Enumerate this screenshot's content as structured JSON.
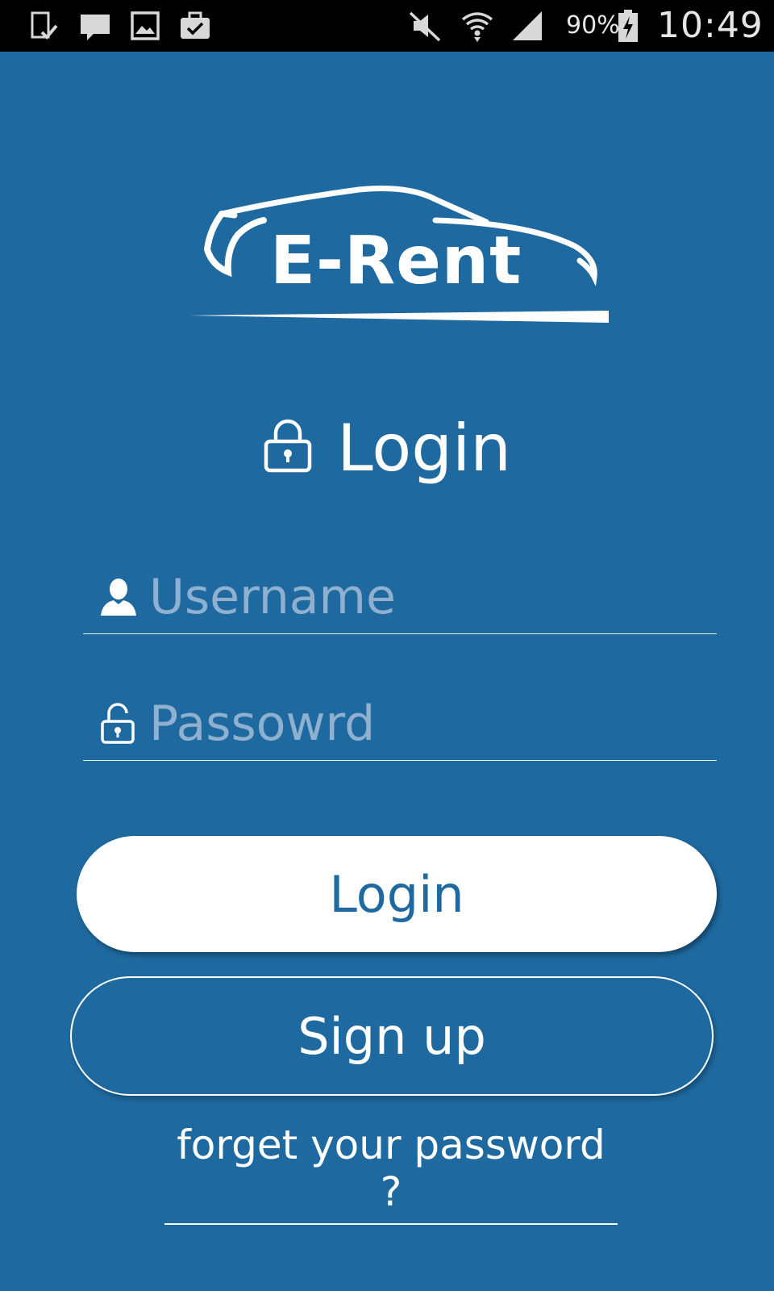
{
  "status_bar": {
    "battery_percent": "90%",
    "time": "10:49",
    "notification_icons": [
      "download-check-icon",
      "message-icon",
      "image-icon",
      "briefcase-check-icon"
    ],
    "system_icons": [
      "mute-icon",
      "wifi-icon",
      "signal-icon",
      "battery-charging-icon"
    ]
  },
  "logo": {
    "brand": "E-Rent",
    "icon": "car-outline-icon"
  },
  "heading": {
    "icon": "lock-icon",
    "title": "Login"
  },
  "form": {
    "username": {
      "icon": "user-icon",
      "placeholder": "Username",
      "value": ""
    },
    "password": {
      "icon": "unlock-icon",
      "placeholder": "Passowrd",
      "value": ""
    }
  },
  "actions": {
    "login_label": "Login",
    "signup_label": "Sign up",
    "forgot_label": "forget your password ?"
  },
  "colors": {
    "background": "#1e699f",
    "primary_text": "#ffffff",
    "placeholder": "#8fb1cf",
    "status_bar": "#000000"
  }
}
